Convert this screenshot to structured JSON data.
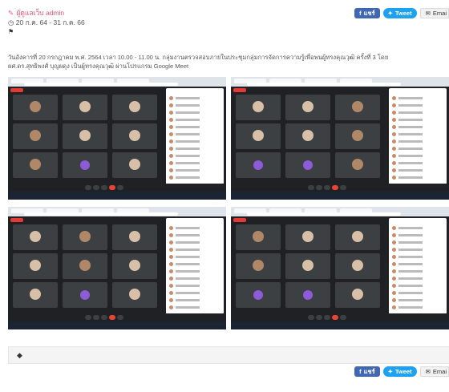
{
  "post": {
    "author": "ผู้ดูแลเว็บ admin",
    "date_range": "20 ก.ค. 64 - 31 ก.ค. 66",
    "flag_icon": "flag-icon",
    "description_line1": "วันอังคารที่ 20 กรกฎาคม พ.ศ. 2564 เวลา 10.00 - 11.00 น. กลุ่มงานตรวจสอบภายในประชุมกลุ่มการจัดการความรู้เพื่อพนผู้ทรงคุณวุฒิ ครั้งที่ 3 โดย",
    "description_line2": "ผศ.ดร.สุทธิพงศ์ บุญผดุง เป็นผู้ทรงคุณวุฒิ ผ่านโปรแกรม Google Meet"
  },
  "share": {
    "facebook_label": "แชร์",
    "tweet_label": "Tweet",
    "email_label": "Emai"
  },
  "colors": {
    "accent": "#e5557a",
    "facebook": "#4267b2",
    "twitter": "#1da1f2",
    "meet_bg": "#202124"
  },
  "comment_icon": "tag-icon"
}
